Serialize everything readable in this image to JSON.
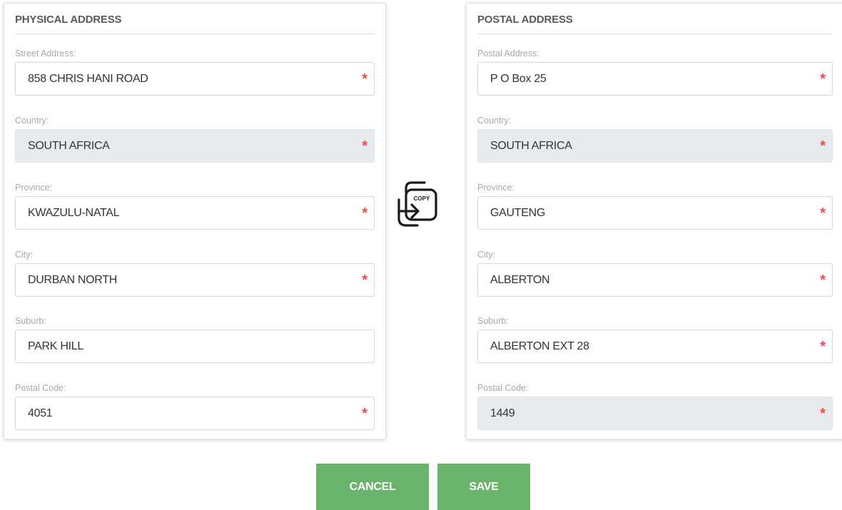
{
  "physical": {
    "title": "PHYSICAL ADDRESS",
    "fields": [
      {
        "label": "Street Address:",
        "value": "858 CHRIS HANI ROAD",
        "required": "*"
      },
      {
        "label": "Country:",
        "value": "SOUTH AFRICA",
        "required": "*"
      },
      {
        "label": "Province:",
        "value": "KWAZULU-NATAL",
        "required": "*"
      },
      {
        "label": "City:",
        "value": "DURBAN NORTH",
        "required": "*"
      },
      {
        "label": "Suburb:",
        "value": "PARK HILL"
      },
      {
        "label": "Postal Code:",
        "value": "4051",
        "required": "*"
      }
    ]
  },
  "postal": {
    "title": "POSTAL ADDRESS",
    "fields": [
      {
        "label": "Postal Address:",
        "value": "P O Box 25",
        "required": "*"
      },
      {
        "label": "Country:",
        "value": "SOUTH AFRICA",
        "required": "*"
      },
      {
        "label": "Province:",
        "value": "GAUTENG",
        "required": "*"
      },
      {
        "label": "City:",
        "value": "ALBERTON",
        "required": "*"
      },
      {
        "label": "Suburb:",
        "value": "ALBERTON EXT 28",
        "required": "*"
      },
      {
        "label": "Postal Code:",
        "value": "1449",
        "required": "*"
      }
    ]
  },
  "copy": {
    "label": "COPY",
    "icon": "copy-icon"
  },
  "actions": {
    "cancel_label": "CANCEL",
    "save_label": "SAVE"
  },
  "colors": {
    "button": "#6ab36a",
    "required": "#f04a4a",
    "readonly_bg": "#e8ebee"
  }
}
